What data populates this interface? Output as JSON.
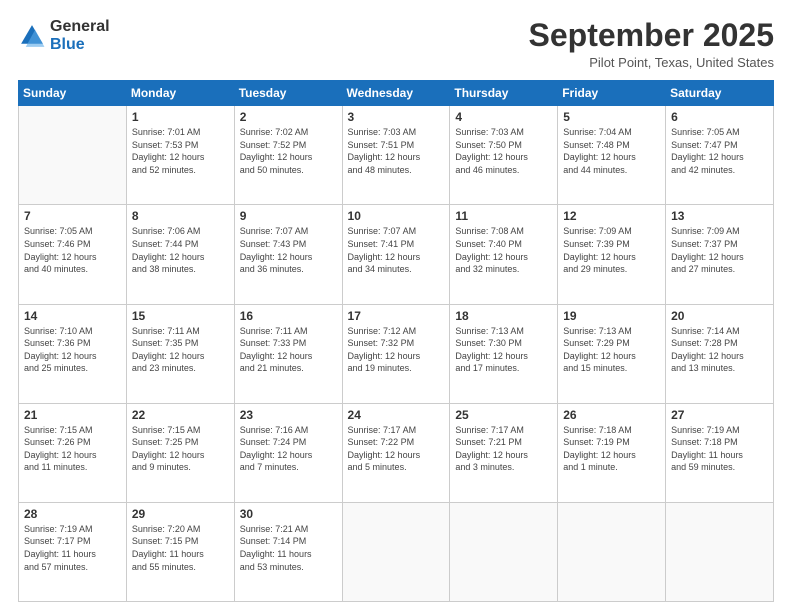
{
  "header": {
    "logo": {
      "line1": "General",
      "line2": "Blue"
    },
    "title": "September 2025",
    "location": "Pilot Point, Texas, United States"
  },
  "weekdays": [
    "Sunday",
    "Monday",
    "Tuesday",
    "Wednesday",
    "Thursday",
    "Friday",
    "Saturday"
  ],
  "weeks": [
    [
      {
        "day": "",
        "info": ""
      },
      {
        "day": "1",
        "info": "Sunrise: 7:01 AM\nSunset: 7:53 PM\nDaylight: 12 hours\nand 52 minutes."
      },
      {
        "day": "2",
        "info": "Sunrise: 7:02 AM\nSunset: 7:52 PM\nDaylight: 12 hours\nand 50 minutes."
      },
      {
        "day": "3",
        "info": "Sunrise: 7:03 AM\nSunset: 7:51 PM\nDaylight: 12 hours\nand 48 minutes."
      },
      {
        "day": "4",
        "info": "Sunrise: 7:03 AM\nSunset: 7:50 PM\nDaylight: 12 hours\nand 46 minutes."
      },
      {
        "day": "5",
        "info": "Sunrise: 7:04 AM\nSunset: 7:48 PM\nDaylight: 12 hours\nand 44 minutes."
      },
      {
        "day": "6",
        "info": "Sunrise: 7:05 AM\nSunset: 7:47 PM\nDaylight: 12 hours\nand 42 minutes."
      }
    ],
    [
      {
        "day": "7",
        "info": "Sunrise: 7:05 AM\nSunset: 7:46 PM\nDaylight: 12 hours\nand 40 minutes."
      },
      {
        "day": "8",
        "info": "Sunrise: 7:06 AM\nSunset: 7:44 PM\nDaylight: 12 hours\nand 38 minutes."
      },
      {
        "day": "9",
        "info": "Sunrise: 7:07 AM\nSunset: 7:43 PM\nDaylight: 12 hours\nand 36 minutes."
      },
      {
        "day": "10",
        "info": "Sunrise: 7:07 AM\nSunset: 7:41 PM\nDaylight: 12 hours\nand 34 minutes."
      },
      {
        "day": "11",
        "info": "Sunrise: 7:08 AM\nSunset: 7:40 PM\nDaylight: 12 hours\nand 32 minutes."
      },
      {
        "day": "12",
        "info": "Sunrise: 7:09 AM\nSunset: 7:39 PM\nDaylight: 12 hours\nand 29 minutes."
      },
      {
        "day": "13",
        "info": "Sunrise: 7:09 AM\nSunset: 7:37 PM\nDaylight: 12 hours\nand 27 minutes."
      }
    ],
    [
      {
        "day": "14",
        "info": "Sunrise: 7:10 AM\nSunset: 7:36 PM\nDaylight: 12 hours\nand 25 minutes."
      },
      {
        "day": "15",
        "info": "Sunrise: 7:11 AM\nSunset: 7:35 PM\nDaylight: 12 hours\nand 23 minutes."
      },
      {
        "day": "16",
        "info": "Sunrise: 7:11 AM\nSunset: 7:33 PM\nDaylight: 12 hours\nand 21 minutes."
      },
      {
        "day": "17",
        "info": "Sunrise: 7:12 AM\nSunset: 7:32 PM\nDaylight: 12 hours\nand 19 minutes."
      },
      {
        "day": "18",
        "info": "Sunrise: 7:13 AM\nSunset: 7:30 PM\nDaylight: 12 hours\nand 17 minutes."
      },
      {
        "day": "19",
        "info": "Sunrise: 7:13 AM\nSunset: 7:29 PM\nDaylight: 12 hours\nand 15 minutes."
      },
      {
        "day": "20",
        "info": "Sunrise: 7:14 AM\nSunset: 7:28 PM\nDaylight: 12 hours\nand 13 minutes."
      }
    ],
    [
      {
        "day": "21",
        "info": "Sunrise: 7:15 AM\nSunset: 7:26 PM\nDaylight: 12 hours\nand 11 minutes."
      },
      {
        "day": "22",
        "info": "Sunrise: 7:15 AM\nSunset: 7:25 PM\nDaylight: 12 hours\nand 9 minutes."
      },
      {
        "day": "23",
        "info": "Sunrise: 7:16 AM\nSunset: 7:24 PM\nDaylight: 12 hours\nand 7 minutes."
      },
      {
        "day": "24",
        "info": "Sunrise: 7:17 AM\nSunset: 7:22 PM\nDaylight: 12 hours\nand 5 minutes."
      },
      {
        "day": "25",
        "info": "Sunrise: 7:17 AM\nSunset: 7:21 PM\nDaylight: 12 hours\nand 3 minutes."
      },
      {
        "day": "26",
        "info": "Sunrise: 7:18 AM\nSunset: 7:19 PM\nDaylight: 12 hours\nand 1 minute."
      },
      {
        "day": "27",
        "info": "Sunrise: 7:19 AM\nSunset: 7:18 PM\nDaylight: 11 hours\nand 59 minutes."
      }
    ],
    [
      {
        "day": "28",
        "info": "Sunrise: 7:19 AM\nSunset: 7:17 PM\nDaylight: 11 hours\nand 57 minutes."
      },
      {
        "day": "29",
        "info": "Sunrise: 7:20 AM\nSunset: 7:15 PM\nDaylight: 11 hours\nand 55 minutes."
      },
      {
        "day": "30",
        "info": "Sunrise: 7:21 AM\nSunset: 7:14 PM\nDaylight: 11 hours\nand 53 minutes."
      },
      {
        "day": "",
        "info": ""
      },
      {
        "day": "",
        "info": ""
      },
      {
        "day": "",
        "info": ""
      },
      {
        "day": "",
        "info": ""
      }
    ]
  ]
}
